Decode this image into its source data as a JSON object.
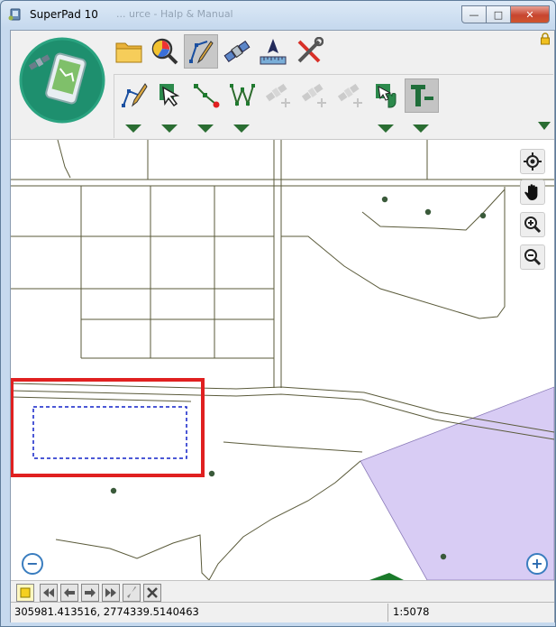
{
  "window": {
    "title": "SuperPad 10",
    "background_text": "... urce - Halp & Manual"
  },
  "window_controls": {
    "minimize": "—",
    "maximize": "□",
    "close": "✕"
  },
  "toolbar": {
    "row1": [
      {
        "name": "open-folder",
        "icon": "folder-icon",
        "active": false
      },
      {
        "name": "query",
        "icon": "magnifier-chart-icon",
        "active": false
      },
      {
        "name": "edit",
        "icon": "pen-vertex-icon",
        "active": true
      },
      {
        "name": "gps",
        "icon": "satellite-icon",
        "active": false
      },
      {
        "name": "measure",
        "icon": "ruler-arrow-icon",
        "active": false
      },
      {
        "name": "settings",
        "icon": "tools-icon",
        "active": false
      }
    ],
    "row2": [
      {
        "name": "draw-line",
        "icon": "pen-line-icon",
        "enabled": true,
        "dropdown": true
      },
      {
        "name": "select-feature",
        "icon": "select-arrow-icon",
        "enabled": true,
        "dropdown": true
      },
      {
        "name": "add-vertex",
        "icon": "vertex-icon",
        "enabled": true,
        "dropdown": true
      },
      {
        "name": "polyline-edit",
        "icon": "polyline-icon",
        "enabled": true,
        "dropdown": true
      },
      {
        "name": "gps-point",
        "icon": "gps-add-icon",
        "enabled": false,
        "dropdown": false
      },
      {
        "name": "gps-line",
        "icon": "gps-add-icon",
        "enabled": false,
        "dropdown": false
      },
      {
        "name": "gps-polygon",
        "icon": "gps-add-icon",
        "enabled": false,
        "dropdown": false
      },
      {
        "name": "attribute-edit",
        "icon": "feature-hand-icon",
        "enabled": true,
        "dropdown": true
      },
      {
        "name": "text-tool",
        "icon": "text-icon",
        "enabled": true,
        "dropdown": true,
        "active": true
      }
    ]
  },
  "map_tools": [
    {
      "name": "locate",
      "icon": "target-icon"
    },
    {
      "name": "pan",
      "icon": "hand-icon"
    },
    {
      "name": "zoom-in",
      "icon": "zoom-in-icon"
    },
    {
      "name": "zoom-out",
      "icon": "zoom-out-icon"
    }
  ],
  "map_nav": {
    "zoom_out_symbol": "−",
    "zoom_in_symbol": "+"
  },
  "colors": {
    "map_lines": "#5a5a3a",
    "polygon_fill": "#d8ccf4",
    "highlight_box": "#e02020",
    "selection_box": "#1020c8",
    "green_feature": "#1a7a2a"
  },
  "status": {
    "coordinates": "305981.413516, 2774339.5140463",
    "scale": "1:5078"
  }
}
